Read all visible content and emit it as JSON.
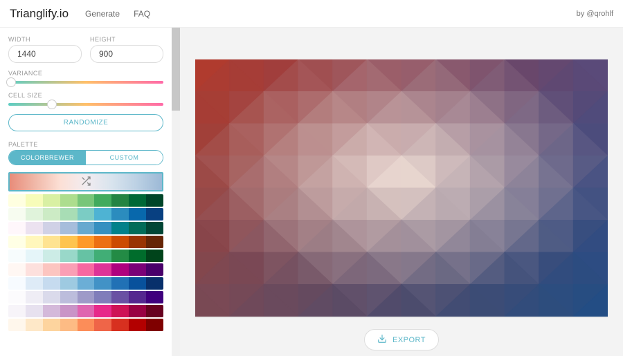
{
  "header": {
    "brand": "Trianglify.io",
    "nav": [
      "Generate",
      "FAQ"
    ],
    "byline": "by @qrohlf"
  },
  "controls": {
    "width_label": "WIDTH",
    "width_value": "1440",
    "height_label": "HEIGHT",
    "height_value": "900",
    "variance_label": "VARIANCE",
    "variance_pct": 2,
    "cellsize_label": "CELL SIZE",
    "cellsize_pct": 28,
    "randomize_label": "RANDOMIZE"
  },
  "palette": {
    "label": "PALETTE",
    "tabs": {
      "colorbrewer": "COLORBREWER",
      "custom": "CUSTOM"
    },
    "selected_gradient": [
      "#e88c7a",
      "#f0b8a8",
      "#fce0d6",
      "#f2ecf0",
      "#d9e4ee",
      "#bcd1e4",
      "#9cb9d6"
    ],
    "rows": [
      [
        "#ffffe0",
        "#f7fcb9",
        "#d9f0a3",
        "#addd8e",
        "#78c679",
        "#41ab5d",
        "#238443",
        "#006837",
        "#004529"
      ],
      [
        "#f7fcf0",
        "#e0f3db",
        "#ccebc5",
        "#a8ddb5",
        "#7bccc4",
        "#4eb3d3",
        "#2b8cbe",
        "#0868ac",
        "#084081"
      ],
      [
        "#fff7fb",
        "#ece2f0",
        "#d0d1e6",
        "#a6bddb",
        "#67a9cf",
        "#3690c0",
        "#02818a",
        "#016c59",
        "#014636"
      ],
      [
        "#ffffe5",
        "#fff7bc",
        "#fee391",
        "#fec44f",
        "#fe9929",
        "#ec7014",
        "#cc4c02",
        "#993404",
        "#662506"
      ],
      [
        "#f7fcfd",
        "#e5f5f9",
        "#ccece6",
        "#99d8c9",
        "#66c2a4",
        "#41ae76",
        "#238b45",
        "#006d2c",
        "#00441b"
      ],
      [
        "#fff7f3",
        "#fde0dd",
        "#fcc5c0",
        "#fa9fb5",
        "#f768a1",
        "#dd3497",
        "#ae017e",
        "#7a0177",
        "#49006a"
      ],
      [
        "#f7fbff",
        "#deebf7",
        "#c6dbef",
        "#9ecae1",
        "#6baed6",
        "#4292c6",
        "#2171b5",
        "#08519c",
        "#08306b"
      ],
      [
        "#fcfbfd",
        "#efedf5",
        "#dadaeb",
        "#bcbddc",
        "#9e9ac8",
        "#807dba",
        "#6a51a3",
        "#54278f",
        "#3f007d"
      ],
      [
        "#f7f4f9",
        "#e7e1ef",
        "#d4b9da",
        "#c994c7",
        "#df65b0",
        "#e7298a",
        "#ce1256",
        "#980043",
        "#67001f"
      ],
      [
        "#fff7ec",
        "#fee8c8",
        "#fdd49e",
        "#fdbb84",
        "#fc8d59",
        "#ef6548",
        "#d7301f",
        "#b30000",
        "#7f0000"
      ]
    ]
  },
  "export_label": "EXPORT",
  "chart_data": {
    "type": "triangulated-gradient",
    "grid": {
      "cols": 12,
      "rows": 8
    },
    "corner_colors": {
      "top_left": "#b53a2a",
      "top_right": "#5a4a7a",
      "center": "#fdeee2",
      "bottom_left": "#7a4a55",
      "bottom_right": "#1d4d85"
    },
    "palette": [
      "#b53a2a",
      "#d66a4e",
      "#f0b8a8",
      "#fdeee2",
      "#cfe0ec",
      "#8ab2d4",
      "#3a72ab",
      "#1d4d85",
      "#6a4d76"
    ]
  }
}
